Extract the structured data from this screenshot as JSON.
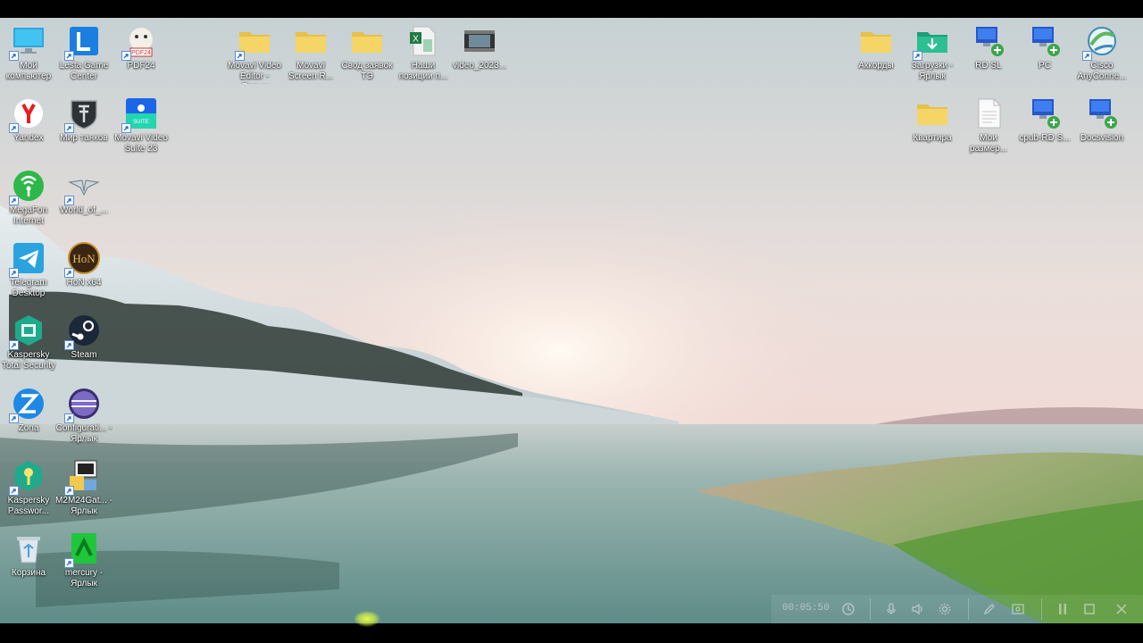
{
  "desktop": {
    "icons": [
      {
        "label": "Мой компьютер",
        "icon": "monitor-icon",
        "shortcut": true
      },
      {
        "label": "Lesta Game Center",
        "icon": "lesta-icon",
        "shortcut": true
      },
      {
        "label": "PDF24",
        "icon": "pdf24-icon",
        "shortcut": true
      },
      {
        "label": "Movavi Video Editor - Ярлык",
        "icon": "folder-icon",
        "shortcut": true
      },
      {
        "label": "Movavi Screen R...",
        "icon": "folder-icon",
        "shortcut": false
      },
      {
        "label": "Свод заявок ТЭ",
        "icon": "folder-icon",
        "shortcut": false
      },
      {
        "label": "Наши позиции п...",
        "icon": "excel-file-icon",
        "shortcut": false
      },
      {
        "label": "video_2023...",
        "icon": "video-file-icon",
        "shortcut": false
      },
      {
        "label": "Аккорды",
        "icon": "folder-icon",
        "shortcut": false
      },
      {
        "label": "Загрузки - Ярлык",
        "icon": "downloads-folder-icon",
        "shortcut": true
      },
      {
        "label": "RD SL",
        "icon": "remote-desktop-icon",
        "shortcut": false
      },
      {
        "label": "PC",
        "icon": "remote-desktop-icon",
        "shortcut": false
      },
      {
        "label": "Cisco AnyConne...",
        "icon": "cisco-icon",
        "shortcut": true
      },
      {
        "label": "Yandex",
        "icon": "yandex-icon",
        "shortcut": true
      },
      {
        "label": "Мир танков",
        "icon": "tank-shield-icon",
        "shortcut": true
      },
      {
        "label": "Movavi Video Suite 23",
        "icon": "movavi-suite-icon",
        "shortcut": true
      },
      {
        "label": "Квартира",
        "icon": "folder-icon",
        "shortcut": false
      },
      {
        "label": "Мои размер...",
        "icon": "document-icon",
        "shortcut": false
      },
      {
        "label": "cpub-RD S...",
        "icon": "remote-desktop-icon",
        "shortcut": false
      },
      {
        "label": "Docsvision",
        "icon": "remote-desktop-icon",
        "shortcut": false
      },
      {
        "label": "MegaFon Internet",
        "icon": "megafon-icon",
        "shortcut": true
      },
      {
        "label": "World_of_...",
        "icon": "wings-icon",
        "shortcut": true
      },
      {
        "label": "Telegram Desktop",
        "icon": "telegram-icon",
        "shortcut": true
      },
      {
        "label": "HoN x64",
        "icon": "hon-icon",
        "shortcut": true
      },
      {
        "label": "Kaspersky Total Security",
        "icon": "kaspersky-icon",
        "shortcut": true
      },
      {
        "label": "Steam",
        "icon": "steam-icon",
        "shortcut": true
      },
      {
        "label": "Zona",
        "icon": "zona-icon",
        "shortcut": true
      },
      {
        "label": "Configurati... - Ярлык",
        "icon": "eclipse-icon",
        "shortcut": true
      },
      {
        "label": "Kaspersky Passwor...",
        "icon": "kaspersky-password-icon",
        "shortcut": true
      },
      {
        "label": "M2M24Gat... - Ярлык",
        "icon": "m2m-gateway-icon",
        "shortcut": true
      },
      {
        "label": "Корзина",
        "icon": "recycle-bin-icon",
        "shortcut": false
      },
      {
        "label": "mercury - Ярлык",
        "icon": "mercury-icon",
        "shortcut": true
      }
    ]
  },
  "recorder_toolbar": {
    "timer": "00:05:50",
    "buttons": [
      "clock-icon",
      "microphone-icon",
      "speaker-icon",
      "settings-icon",
      "pencil-icon",
      "webcam-icon",
      "pause-icon",
      "stop-icon",
      "close-icon"
    ]
  },
  "colors": {
    "sky_top": "#c9d3d6",
    "sky_glow": "#f2e2de",
    "water": "#7c9f9a",
    "grass": "#7ea25a"
  }
}
